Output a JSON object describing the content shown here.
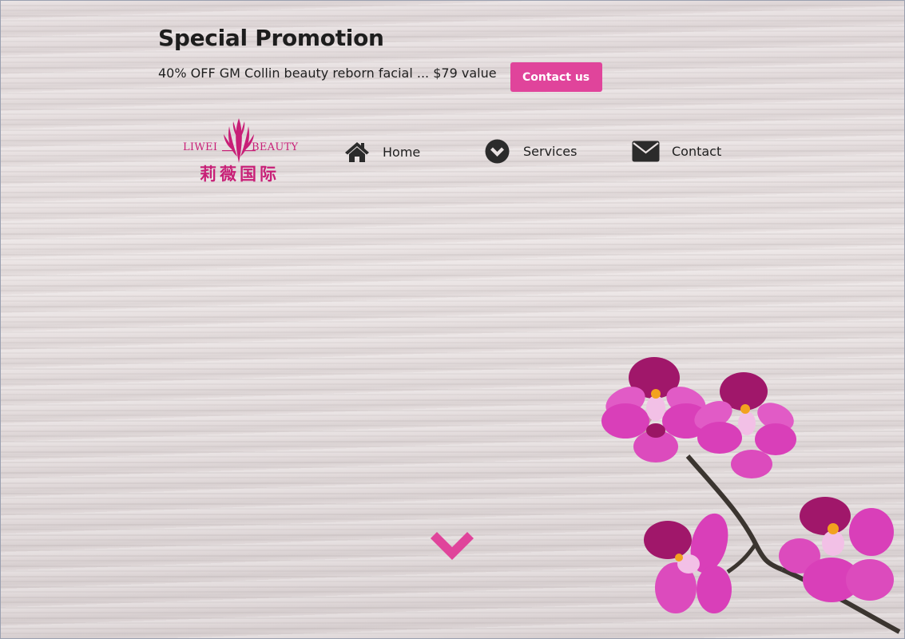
{
  "promo": {
    "title": "Special Promotion",
    "text": "40% OFF GM Collin beauty reborn facial ... $79 value",
    "button_label": "Contact us"
  },
  "logo": {
    "name_left": "LIWEI",
    "name_right": "BEAUTY",
    "chinese_name": "莉薇国际"
  },
  "nav": {
    "items": [
      {
        "label": "Home",
        "icon": "home-icon"
      },
      {
        "label": "Services",
        "icon": "chevron-circle-down-icon"
      },
      {
        "label": "Contact",
        "icon": "envelope-icon"
      }
    ]
  },
  "scroll": {
    "icon": "chevron-down-icon"
  },
  "colors": {
    "accent": "#e0449b",
    "brand": "#c81f77",
    "text": "#1f1f1f",
    "orchid": "#cc2fa8"
  }
}
